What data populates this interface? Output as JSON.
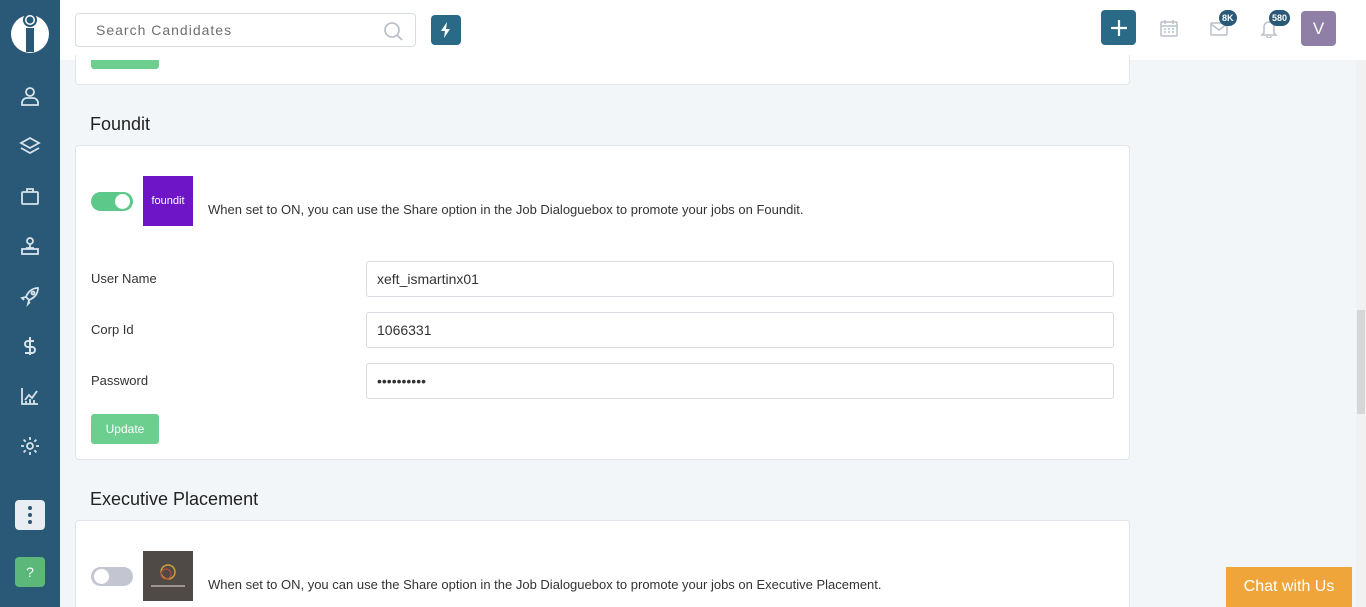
{
  "header": {
    "search_placeholder": "Search Candidates",
    "mail_badge": "8K",
    "notification_badge": "580",
    "avatar_initial": "V"
  },
  "sidebar": {
    "help_label": "?"
  },
  "sections": {
    "foundit": {
      "title": "Foundit",
      "enabled": true,
      "logo_text": "foundit",
      "description": "When set to ON, you can use the Share option in the Job Dialoguebox to promote your jobs on Foundit.",
      "fields": {
        "username_label": "User Name",
        "username_value": "xeft_ismartinx01",
        "corp_label": "Corp Id",
        "corp_value": "1066331",
        "password_label": "Password",
        "password_value": "••••••••••"
      },
      "update_label": "Update"
    },
    "executive": {
      "title": "Executive Placement",
      "enabled": false,
      "description": "When set to ON, you can use the Share option in the Job Dialoguebox to promote your jobs on Executive Placement."
    }
  },
  "chat": {
    "label": "Chat with Us"
  },
  "colors": {
    "sidebar": "#2a5877",
    "accent": "#2a6a86",
    "toggle_on": "#5cc98a",
    "button_green": "#6ccf90",
    "foundit_purple": "#6e16c7",
    "chat_orange": "#f0a53a"
  }
}
